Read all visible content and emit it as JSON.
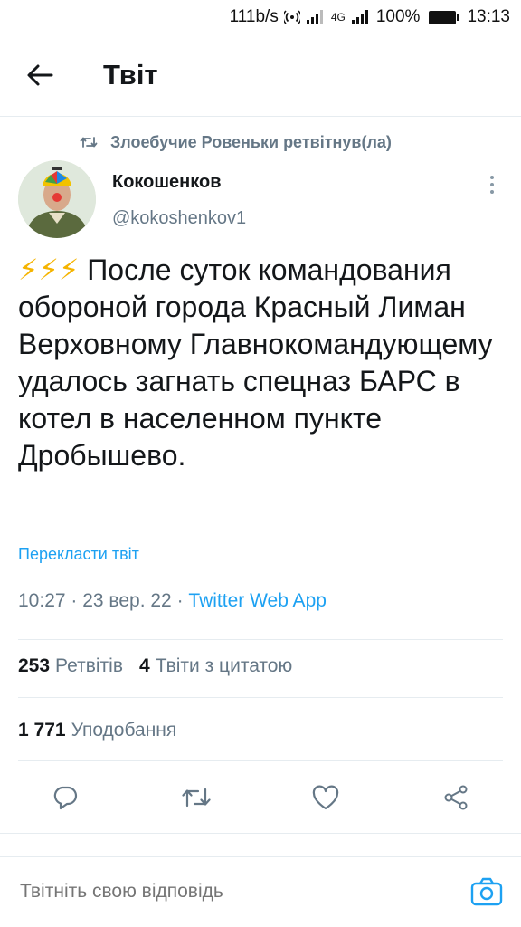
{
  "status_bar": {
    "speed": "111b/s",
    "network": "4G",
    "battery": "100%",
    "time": "13:13"
  },
  "app_bar": {
    "title": "Твіт"
  },
  "retweet": {
    "text": "Злоебучие Ровеньки ретвітнув(ла)"
  },
  "author": {
    "name": "Кокошенков",
    "handle": "@kokoshenkov1"
  },
  "tweet": {
    "emoji": "⚡⚡⚡",
    "text": "После суток командования обороной города Красный Лиман Верховному Главнокомандующему удалось загнать спецназ БАРС в котел в населенном пункте Дробышево.",
    "translate_label": "Перекласти твіт",
    "time": "10:27",
    "date": "23 вер. 22",
    "source": "Twitter Web App"
  },
  "stats": {
    "retweets_count": "253",
    "retweets_label": "Ретвітів",
    "quotes_count": "4",
    "quotes_label": "Твіти з цитатою",
    "likes_count": "1 771",
    "likes_label": "Уподобання"
  },
  "reply": {
    "placeholder": "Твітніть свою відповідь"
  },
  "colors": {
    "accent": "#1da1f2",
    "secondary_text": "#657786",
    "divider": "#e6ecf0"
  },
  "icons": [
    "back-arrow-icon",
    "retweet-icon",
    "more-vertical-icon",
    "reply-icon",
    "retweet-action-icon",
    "like-icon",
    "share-icon",
    "camera-icon"
  ]
}
